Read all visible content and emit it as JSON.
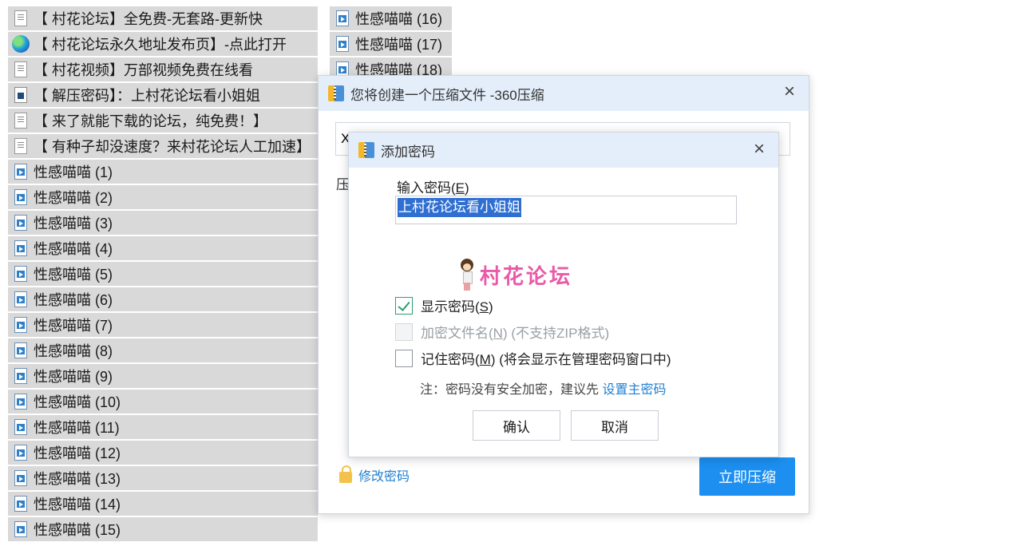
{
  "left_files": [
    {
      "icon": "text-file-icon",
      "name": "【 村花论坛】全免费-无套路-更新快"
    },
    {
      "icon": "edge-shortcut-icon",
      "name": "【 村花论坛永久地址发布页】-点此打开"
    },
    {
      "icon": "text-file-icon",
      "name": "【 村花视频】万部视频免费在线看"
    },
    {
      "icon": "image-file-icon",
      "name": "【 解压密码】：上村花论坛看小姐姐"
    },
    {
      "icon": "text-file-icon",
      "name": "【 来了就能下载的论坛，纯免费！】"
    },
    {
      "icon": "text-file-icon",
      "name": "【 有种子却没速度？来村花论坛人工加速】"
    },
    {
      "icon": "video-file-icon",
      "name": "性感喵喵 (1)"
    },
    {
      "icon": "video-file-icon",
      "name": "性感喵喵 (2)"
    },
    {
      "icon": "video-file-icon",
      "name": "性感喵喵 (3)"
    },
    {
      "icon": "video-file-icon",
      "name": "性感喵喵 (4)"
    },
    {
      "icon": "video-file-icon",
      "name": "性感喵喵 (5)"
    },
    {
      "icon": "video-file-icon",
      "name": "性感喵喵 (6)"
    },
    {
      "icon": "video-file-icon",
      "name": "性感喵喵 (7)"
    },
    {
      "icon": "video-file-icon",
      "name": "性感喵喵 (8)"
    },
    {
      "icon": "video-file-icon",
      "name": "性感喵喵 (9)"
    },
    {
      "icon": "video-file-icon",
      "name": "性感喵喵 (10)"
    },
    {
      "icon": "video-file-icon",
      "name": "性感喵喵 (11)"
    },
    {
      "icon": "video-file-icon",
      "name": "性感喵喵 (12)"
    },
    {
      "icon": "video-file-icon",
      "name": "性感喵喵 (13)"
    },
    {
      "icon": "video-file-icon",
      "name": "性感喵喵 (14)"
    },
    {
      "icon": "video-file-icon",
      "name": "性感喵喵 (15)"
    }
  ],
  "right_files": [
    {
      "icon": "video-file-icon",
      "name": "性感喵喵 (16)"
    },
    {
      "icon": "video-file-icon",
      "name": "性感喵喵 (17)"
    },
    {
      "icon": "video-file-icon",
      "name": "性感喵喵 (18)"
    }
  ],
  "compress_dialog": {
    "title": "您将创建一个压缩文件 -360压缩",
    "path_value": "X",
    "label_partial": "压",
    "change_password_link": "修改密码",
    "compress_now_button": "立即压缩"
  },
  "password_dialog": {
    "title": "添加密码",
    "input_label": "输入密码(",
    "input_label_key": "E",
    "input_label_end": ")",
    "password_value": "上村花论坛看小姐姐",
    "watermark_text": "村花论坛",
    "show_password": {
      "label": "显示密码(",
      "key": "S",
      "end": ")",
      "checked": true
    },
    "encrypt_filenames": {
      "label": "加密文件名(",
      "key": "N",
      "end": ") (不支持ZIP格式)",
      "checked": false,
      "disabled": true
    },
    "remember_password": {
      "label": "记住密码(",
      "key": "M",
      "end": ") (将会显示在管理密码窗口中)",
      "checked": false
    },
    "note_text": "注：密码没有安全加密，建议先 ",
    "note_link": "设置主密码",
    "ok_button": "确认",
    "cancel_button": "取消"
  },
  "colors": {
    "titlebar_bg": "#e3eefa",
    "primary_button": "#1c8ff0",
    "link": "#1f7fd0",
    "watermark": "#e95aa8",
    "selection": "#2f6fd1",
    "list_item_bg": "#d9d9d9"
  }
}
